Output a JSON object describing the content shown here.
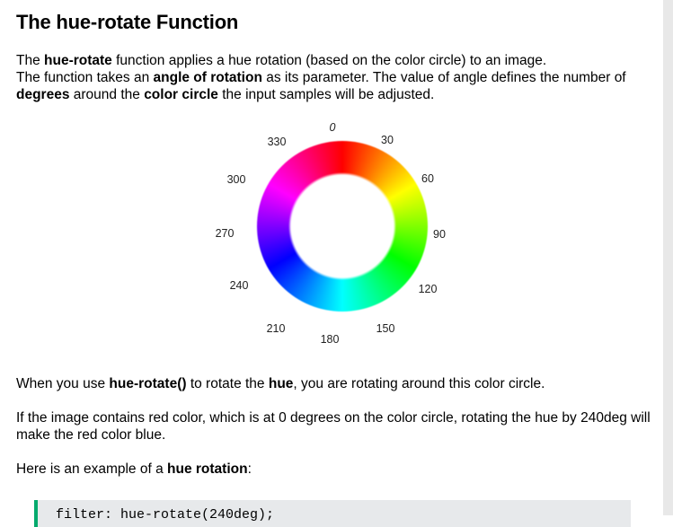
{
  "heading": "The hue-rotate Function",
  "intro": {
    "l1_a": "The ",
    "l1_b": "hue-rotate",
    "l1_c": " function applies a hue rotation (based on the color circle) to an image.",
    "l2_a": "The function takes an ",
    "l2_b": "angle of rotation",
    "l2_c": " as its parameter. The value of angle defines the number of",
    "l3_a": "degrees",
    "l3_b": " around the ",
    "l3_c": "color circle",
    "l3_d": " the input samples will be adjusted."
  },
  "wheel": {
    "labels": {
      "d0": "0",
      "d30": "30",
      "d60": "60",
      "d90": "90",
      "d120": "120",
      "d150": "150",
      "d180": "180",
      "d210": "210",
      "d240": "240",
      "d270": "270",
      "d300": "300",
      "d330": "330"
    }
  },
  "p2": {
    "a": "When you use ",
    "b": "hue-rotate()",
    "c": " to rotate the ",
    "d": "hue",
    "e": ", you are rotating around this color circle."
  },
  "p3": {
    "text": "If the image contains red color, which is at 0 degrees on the color circle, rotating the hue by 240deg will make the red color blue."
  },
  "p4": {
    "a": "Here is an example of a ",
    "b": "hue rotation",
    "c": ":"
  },
  "code": {
    "line1": "filter: hue-rotate(240deg);"
  },
  "colors": {
    "code_border": "#04aa6d",
    "code_bg": "#e7e9eb",
    "scrollbar_track": "#e8e8e8"
  }
}
